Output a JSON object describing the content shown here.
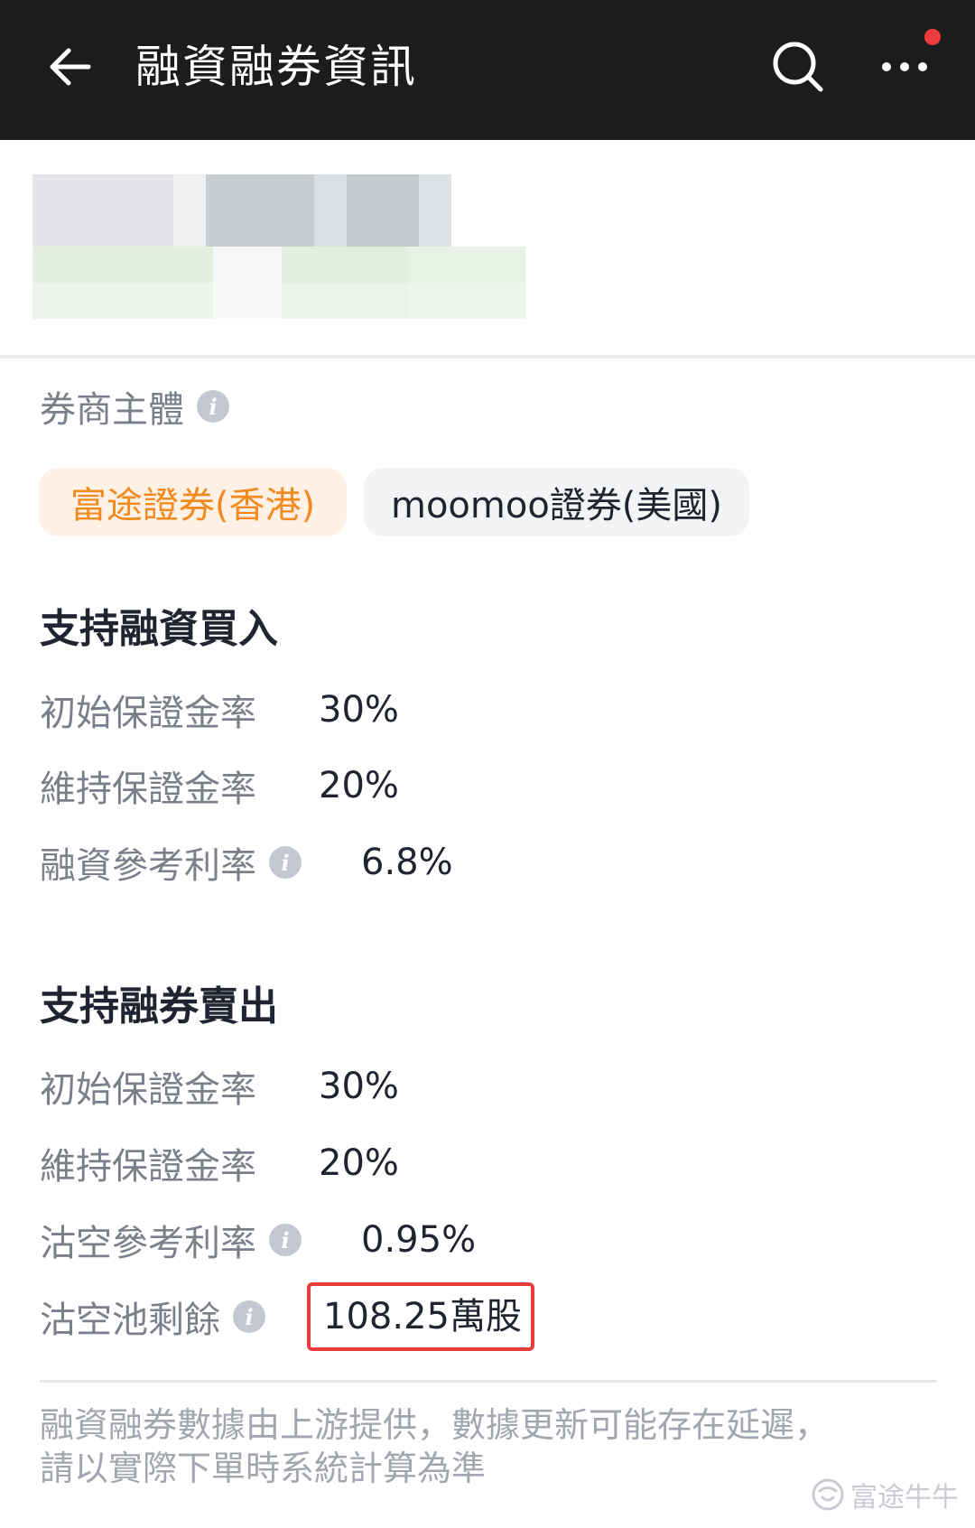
{
  "header": {
    "title": "融資融券資訊"
  },
  "stock_card": {},
  "broker": {
    "label": "券商主體",
    "options": [
      {
        "label": "富途證券(香港)",
        "selected": true
      },
      {
        "label": "moomoo證券(美國)",
        "selected": false
      }
    ]
  },
  "margin_buy": {
    "title": "支持融資買入",
    "rows": [
      {
        "label": "初始保證金率",
        "value": "30%"
      },
      {
        "label": "維持保證金率",
        "value": "20%"
      },
      {
        "label": "融資參考利率",
        "value": "6.8%"
      }
    ]
  },
  "short_sell": {
    "title": "支持融券賣出",
    "rows": [
      {
        "label": "初始保證金率",
        "value": "30%"
      },
      {
        "label": "維持保證金率",
        "value": "20%"
      },
      {
        "label": "沽空參考利率",
        "value": "0.95%"
      },
      {
        "label": "沽空池剩餘",
        "value": "108.25萬股"
      }
    ]
  },
  "footer": {
    "note_line1": "融資融券數據由上游提供，數據更新可能存在延遲，",
    "note_line2": "請以實際下單時系統計算為準"
  },
  "watermark": {
    "text": "富途牛牛"
  },
  "colors": {
    "header_bg": "#1c1c1e",
    "accent_orange": "#f28a1f",
    "highlight_red": "#e83b3b",
    "notification_dot": "#ef3b3b"
  }
}
